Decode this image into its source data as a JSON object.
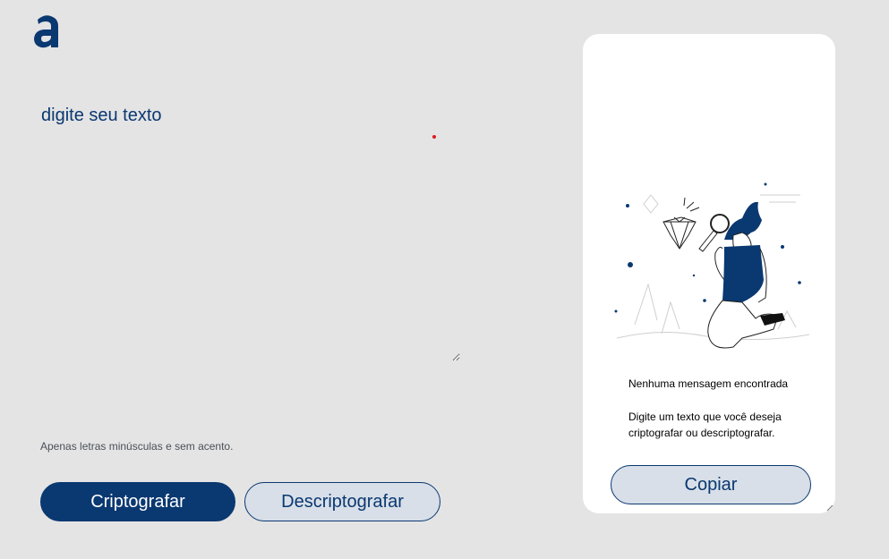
{
  "logo": {
    "glyph": "a"
  },
  "input": {
    "placeholder": "digite seu texto"
  },
  "hint": {
    "text": "Apenas letras minúsculas e sem acento."
  },
  "actions": {
    "encrypt_label": "Criptografar",
    "decrypt_label": "Descriptografar"
  },
  "output": {
    "title": "Nenhuma mensagem encontrada",
    "description": "Digite um texto que você deseja criptografar ou descriptografar.",
    "copy_label": "Copiar"
  },
  "colors": {
    "primary": "#0a3871",
    "secondary_bg": "#d8dfe8",
    "page_bg": "#e4e4e4",
    "panel_bg": "#ffffff",
    "accent_dot": "#e01b1b"
  }
}
